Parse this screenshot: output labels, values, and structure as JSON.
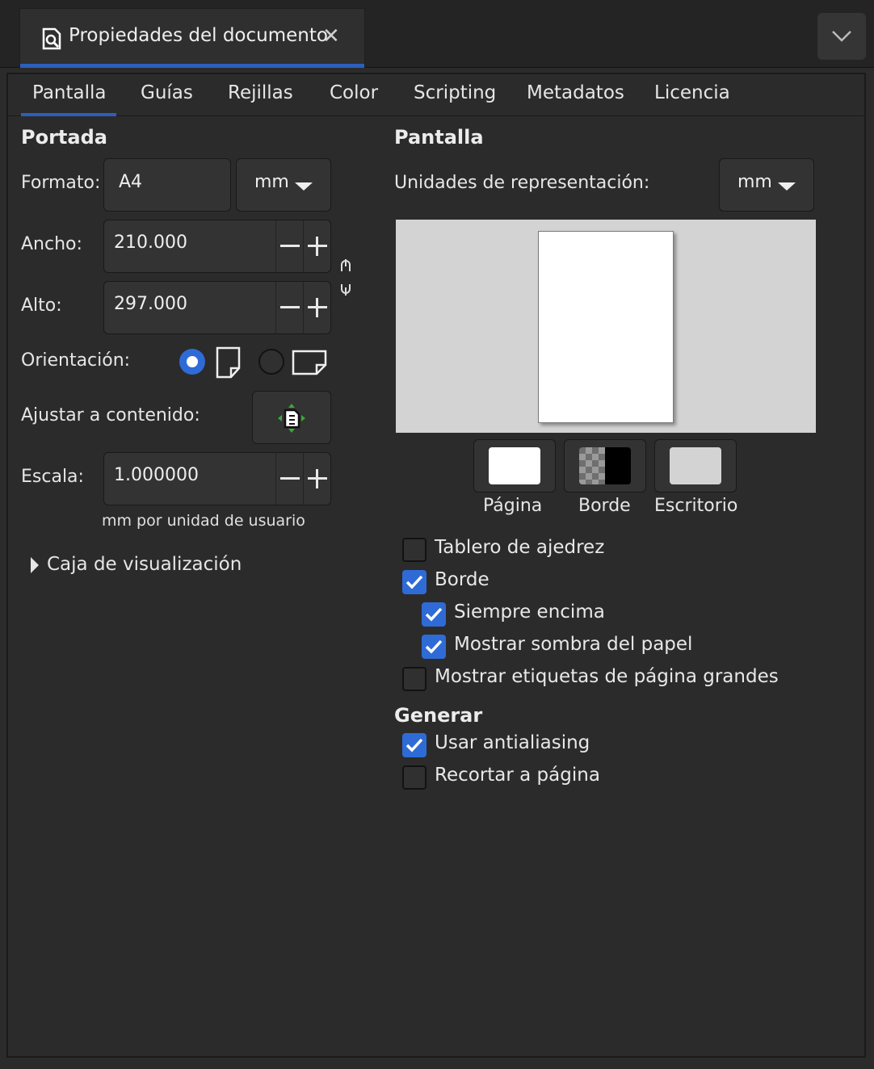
{
  "window": {
    "doc_tab_title": "Propiedades del documento",
    "close_glyph": "✕",
    "doc_tab_icon": "document-properties-icon",
    "menu_icon": "chevron-down-icon"
  },
  "tabs": [
    {
      "label": "Pantalla",
      "active": true
    },
    {
      "label": "Guías",
      "active": false
    },
    {
      "label": "Rejillas",
      "active": false
    },
    {
      "label": "Color",
      "active": false
    },
    {
      "label": "Scripting",
      "active": false
    },
    {
      "label": "Metadatos",
      "active": false
    },
    {
      "label": "Licencia",
      "active": false
    }
  ],
  "portada": {
    "heading": "Portada",
    "format_label": "Formato:",
    "format_value": "A4",
    "format_unit": "mm",
    "width_label": "Ancho:",
    "width_value": "210.000",
    "height_label": "Alto:",
    "height_value": "297.000",
    "orientation_label": "Orientación:",
    "orientation_selected": "portrait",
    "fit_label": "Ajustar a contenido:",
    "scale_label": "Escala:",
    "scale_value": "1.000000",
    "scale_hint": "mm por unidad de usuario",
    "viewbox_label": "Caja de visualización"
  },
  "pantalla": {
    "heading": "Pantalla",
    "units_label": "Unidades de representación:",
    "units_value": "mm",
    "swatches": [
      {
        "label": "Página",
        "color": "#ffffff"
      },
      {
        "label": "Borde",
        "color": "#000000"
      },
      {
        "label": "Escritorio",
        "color": "#d3d3d3"
      }
    ],
    "options": [
      {
        "label": "Tablero de ajedrez",
        "checked": false
      },
      {
        "label": "Borde",
        "checked": true
      },
      {
        "label": "Siempre encima",
        "checked": true
      },
      {
        "label": "Mostrar sombra del papel",
        "checked": true
      },
      {
        "label": "Mostrar etiquetas de página grandes",
        "checked": false
      }
    ]
  },
  "generar": {
    "heading": "Generar",
    "options": [
      {
        "label": "Usar antialiasing",
        "checked": true
      },
      {
        "label": "Recortar a página",
        "checked": false
      }
    ]
  },
  "colors": {
    "accent": "#2c5fbc",
    "checkbox_on": "#2f6bd6",
    "background": "#2b2b2b",
    "preview_desk": "#d3d3d3"
  }
}
